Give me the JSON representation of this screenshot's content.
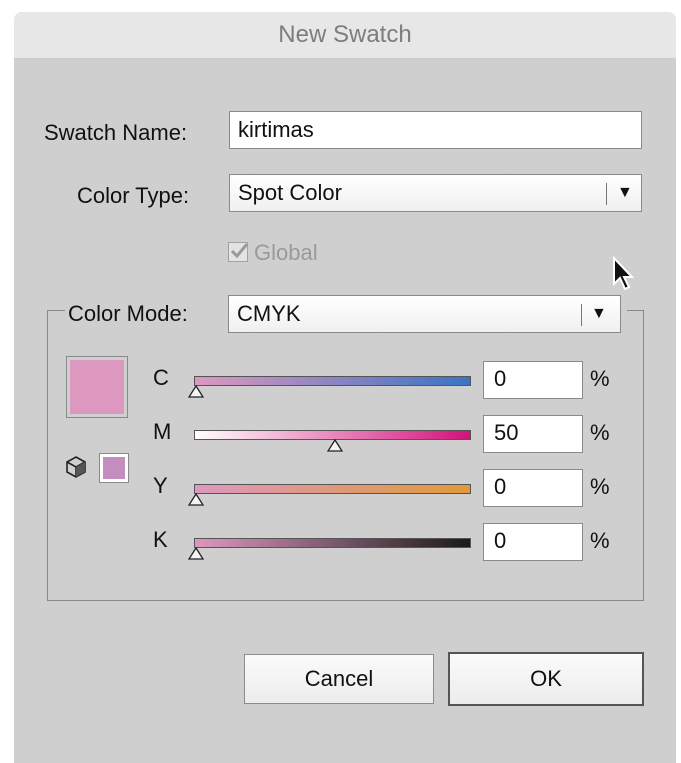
{
  "dialog": {
    "title": "New Swatch"
  },
  "form": {
    "swatch_name_label": "Swatch Name:",
    "swatch_name_value": "kirtimas",
    "color_type_label": "Color Type:",
    "color_type_value": "Spot Color",
    "global_label": "Global",
    "global_checked": true
  },
  "color_mode": {
    "label": "Color Mode:",
    "value": "CMYK",
    "swatch_color": "#dd98bf",
    "gamut_swatch_color": "#c48fbf",
    "sliders": [
      {
        "letter": "C",
        "value": "0",
        "unit": "%",
        "fraction": 0.0,
        "track_end_color": "#3a73c4"
      },
      {
        "letter": "M",
        "value": "50",
        "unit": "%",
        "fraction": 0.5,
        "track_end_color": "#d3127a"
      },
      {
        "letter": "Y",
        "value": "0",
        "unit": "%",
        "fraction": 0.0,
        "track_end_color": "#e09a3a"
      },
      {
        "letter": "K",
        "value": "0",
        "unit": "%",
        "fraction": 0.0,
        "track_end_color": "#1a1a1a"
      }
    ]
  },
  "buttons": {
    "cancel": "Cancel",
    "ok": "OK"
  },
  "icons": {
    "dropdown": "triangle-down-icon",
    "checkbox": "checkmark-icon",
    "gamut": "cube-icon",
    "cursor": "arrow-cursor-icon"
  }
}
